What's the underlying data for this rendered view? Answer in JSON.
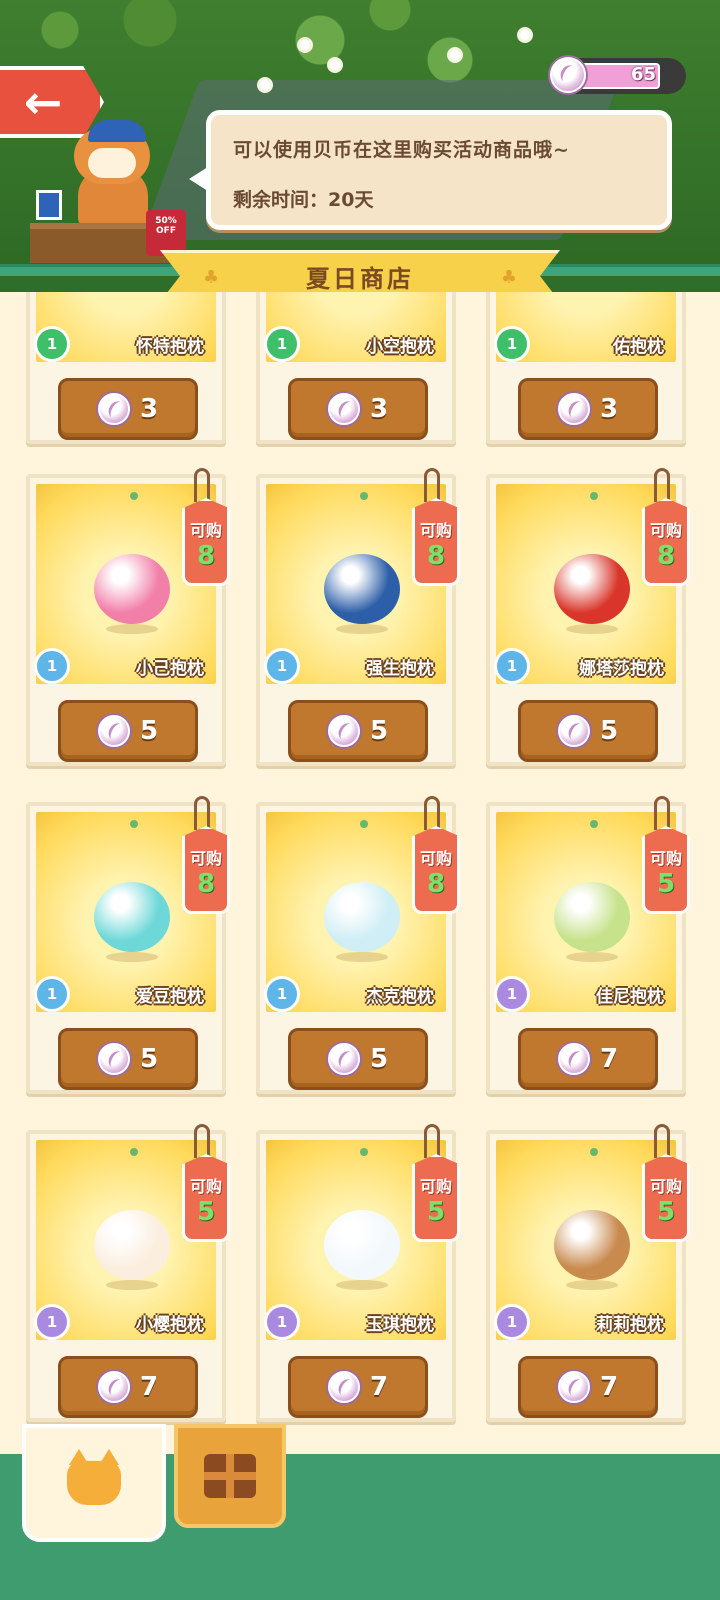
{
  "header": {
    "currency_amount": "65",
    "npc_message": "可以使用贝币在这里购买活动商品哦~",
    "remaining_time": "剩余时间：20天",
    "sale_badge": "50% OFF"
  },
  "shop": {
    "title": "夏日商店",
    "buy_label": "可购",
    "top_row": [
      {
        "name": "怀特抱枕",
        "level": "1",
        "price": "3"
      },
      {
        "name": "小空抱枕",
        "level": "1",
        "price": "3"
      },
      {
        "name": "佑抱枕",
        "level": "1",
        "price": "3"
      }
    ],
    "items": [
      {
        "name": "小己抱枕",
        "level": "1",
        "price": "5",
        "remaining": "8",
        "color": "#f27fa8"
      },
      {
        "name": "强生抱枕",
        "level": "1",
        "price": "5",
        "remaining": "8",
        "color": "#2d5fa8"
      },
      {
        "name": "娜塔莎抱枕",
        "level": "1",
        "price": "5",
        "remaining": "8",
        "color": "#d9352a"
      },
      {
        "name": "爱豆抱枕",
        "level": "1",
        "price": "5",
        "remaining": "8",
        "color": "#6ed8d8"
      },
      {
        "name": "杰克抱枕",
        "level": "1",
        "price": "5",
        "remaining": "8",
        "color": "#cfeef6"
      },
      {
        "name": "佳尼抱枕",
        "level": "1",
        "price": "7",
        "remaining": "5",
        "color": "#c6e28a"
      },
      {
        "name": "小樱抱枕",
        "level": "1",
        "price": "7",
        "remaining": "5",
        "color": "#fbeede"
      },
      {
        "name": "玉琪抱枕",
        "level": "1",
        "price": "7",
        "remaining": "5",
        "color": "#f2f8fc"
      },
      {
        "name": "莉莉抱枕",
        "level": "1",
        "price": "7",
        "remaining": "5",
        "color": "#c98a4e"
      }
    ]
  },
  "colors": {
    "level_green": "#3fbf6a",
    "level_blue": "#5db5e8",
    "level_purple": "#a98ae0",
    "price_button": "#c0782f",
    "tag": "#ed6c4f"
  },
  "tabs": [
    {
      "icon": "cat-icon",
      "selected": true
    },
    {
      "icon": "gift-box-icon",
      "selected": false
    }
  ]
}
